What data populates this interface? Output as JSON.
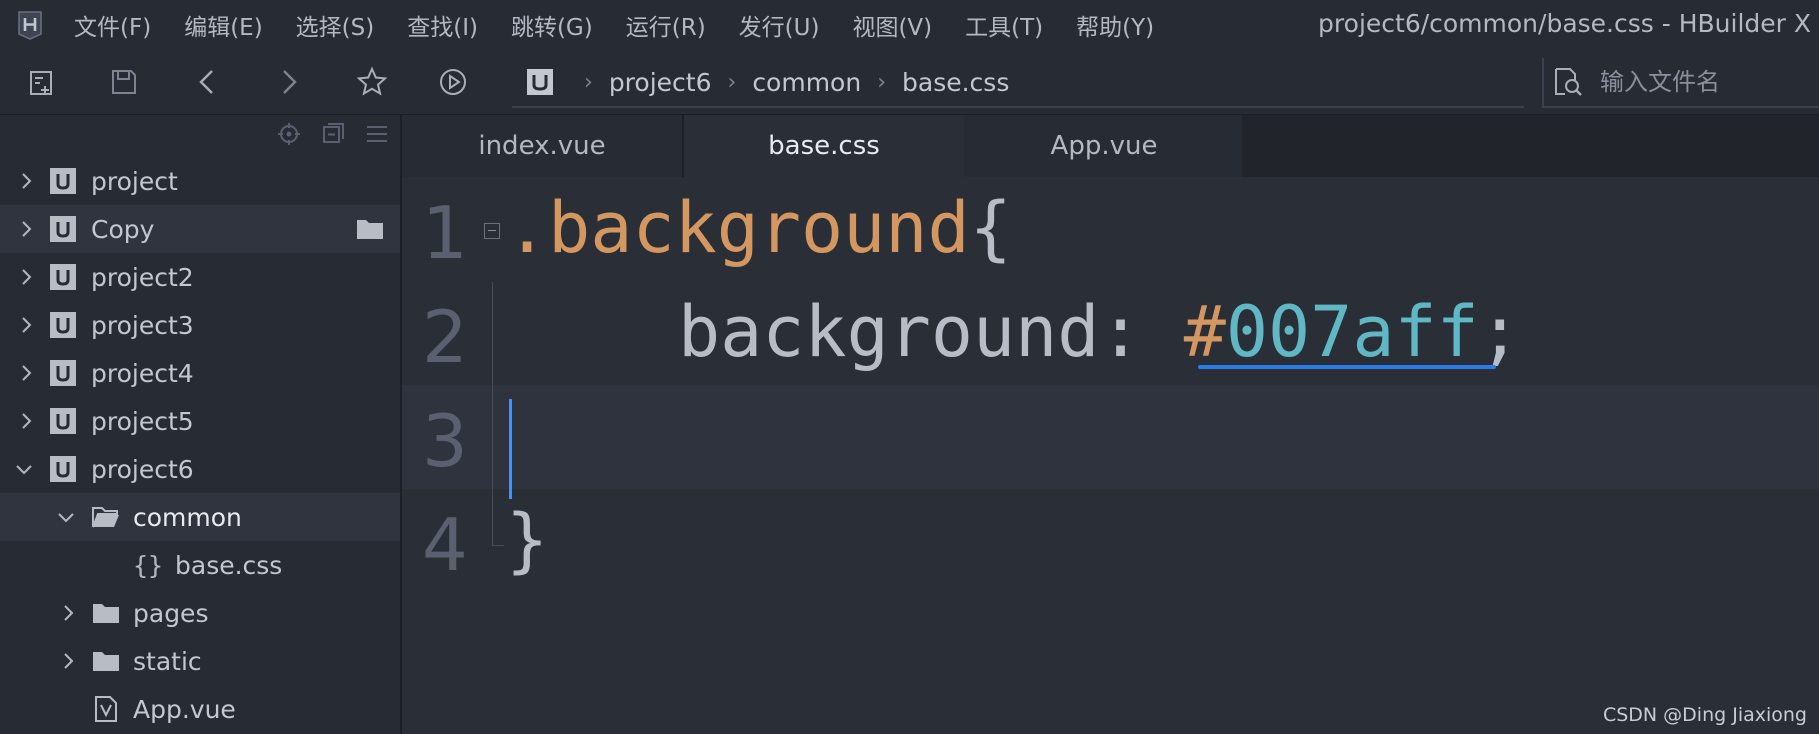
{
  "app": {
    "window_title": "project6/common/base.css - HBuilder X"
  },
  "menu": [
    "文件(F)",
    "编辑(E)",
    "选择(S)",
    "查找(I)",
    "跳转(G)",
    "运行(R)",
    "发行(U)",
    "视图(V)",
    "工具(T)",
    "帮助(Y)"
  ],
  "toolbar": {
    "icons": [
      "new-file-icon",
      "save-icon",
      "back-icon",
      "forward-icon",
      "star-icon",
      "run-icon"
    ],
    "breadcrumb": [
      "project6",
      "common",
      "base.css"
    ],
    "file_search_placeholder": "输入文件名"
  },
  "sidebar": {
    "items": [
      {
        "label": "project",
        "type": "project",
        "expanded": false
      },
      {
        "label": "Copy",
        "type": "project",
        "expanded": false
      },
      {
        "label": "project2",
        "type": "project",
        "expanded": false
      },
      {
        "label": "project3",
        "type": "project",
        "expanded": false
      },
      {
        "label": "project4",
        "type": "project",
        "expanded": false
      },
      {
        "label": "project5",
        "type": "project",
        "expanded": false
      },
      {
        "label": "project6",
        "type": "project",
        "expanded": true
      },
      {
        "label": "common",
        "type": "folder",
        "expanded": true
      },
      {
        "label": "base.css",
        "type": "css-file"
      },
      {
        "label": "pages",
        "type": "folder",
        "expanded": false
      },
      {
        "label": "static",
        "type": "folder",
        "expanded": false
      },
      {
        "label": "App.vue",
        "type": "vue-file"
      }
    ]
  },
  "editor": {
    "tabs": [
      {
        "label": "index.vue",
        "active": false
      },
      {
        "label": "base.css",
        "active": true
      },
      {
        "label": "App.vue",
        "active": false
      }
    ],
    "lines": [
      {
        "num": "1",
        "tokens": {
          "dot": ".",
          "selector": "background",
          "brace": "{"
        }
      },
      {
        "num": "2",
        "tokens": {
          "property": "background",
          "colon": ": ",
          "hash": "#",
          "value": "007aff",
          "semicolon": ";"
        }
      },
      {
        "num": "3"
      },
      {
        "num": "4",
        "tokens": {
          "brace": "}"
        }
      }
    ],
    "colors": {
      "selector": "#d3975f",
      "value": "#5fb8c4",
      "cursor": "#4a90f0",
      "underline": "#2a7de8"
    }
  },
  "watermark": "CSDN @Ding Jiaxiong"
}
